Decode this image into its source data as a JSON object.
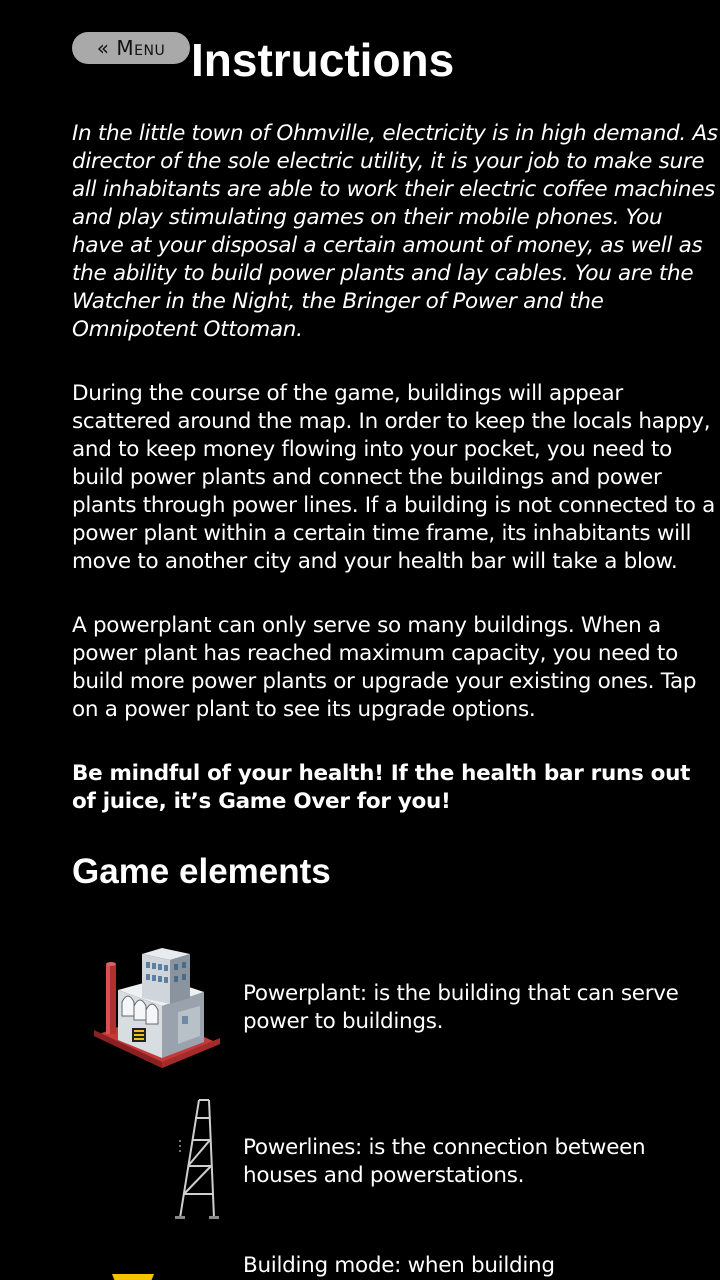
{
  "header": {
    "menu_button": "« Menu",
    "title": "Instructions"
  },
  "paragraphs": {
    "intro": "In the little town of Ohmville, electricity is in high demand. As director of the sole electric utility, it is your job to make sure all inhabitants are able to work their electric coffee machines and play stimulating games on their mobile phones. You have at your disposal a certain amount of money, as well as the ability to build power plants and lay cables. You are the Watcher in the Night, the Bringer of Power and the Omnipotent Ottoman.",
    "gameplay": "During the course of the game, buildings will appear scattered around the map. In order to keep the locals happy, and to keep money flowing into your pocket, you need to build power plants and connect the buildings and power plants through power lines. If a building is not connected to a power plant within a certain time frame, its inhabitants will move to another city and your health bar will take a blow.",
    "capacity": "A powerplant can only serve so many buildings. When a power plant has reached maximum capacity, you need to build more power plants or upgrade your existing ones. Tap on a power plant to see its upgrade options.",
    "warning": "Be mindful of your health! If the health bar runs out of juice, it’s Game Over for you!"
  },
  "game_elements": {
    "heading": "Game elements",
    "items": [
      {
        "icon": "powerplant-icon",
        "text": "Powerplant: is the building that can serve power to buildings."
      },
      {
        "icon": "powerline-icon",
        "text": "Powerlines: is the connection between houses and powerstations."
      },
      {
        "icon": "building-mode-icon",
        "text": "Building mode: when building"
      }
    ]
  }
}
